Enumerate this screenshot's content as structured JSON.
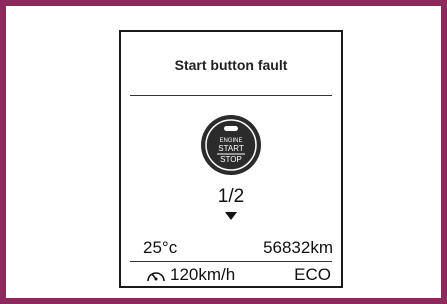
{
  "panel": {
    "title": "Start button fault",
    "button": {
      "line1": "ENGINE",
      "line2": "START",
      "line3": "STOP"
    },
    "page_indicator": "1/2",
    "temperature": "25°c",
    "odometer": "56832km",
    "speed": "120km/h",
    "mode": "ECO"
  },
  "colors": {
    "frame": "#8c2a5e",
    "text": "#111111",
    "button_fill": "#2b2b2b"
  },
  "icons": [
    "engine-start-stop-icon",
    "chevron-down-icon",
    "speedometer-icon"
  ]
}
